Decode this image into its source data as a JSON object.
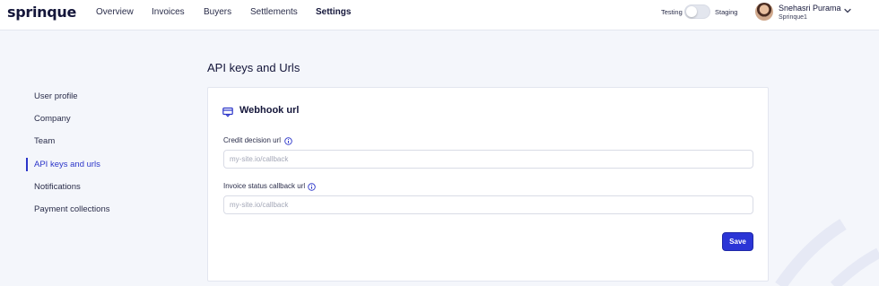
{
  "brand": {
    "logo_text": "sprinque"
  },
  "nav": {
    "items": [
      {
        "label": "Overview",
        "active": false
      },
      {
        "label": "Invoices",
        "active": false
      },
      {
        "label": "Buyers",
        "active": false
      },
      {
        "label": "Settlements",
        "active": false
      },
      {
        "label": "Settings",
        "active": true
      }
    ]
  },
  "environment": {
    "left_label": "Testing",
    "right_label": "Staging",
    "toggle_on": false
  },
  "user": {
    "name": "Snehasri Purama",
    "org": "Sprinque1"
  },
  "sidebar": {
    "items": [
      {
        "label": "User profile",
        "active": false
      },
      {
        "label": "Company",
        "active": false
      },
      {
        "label": "Team",
        "active": false
      },
      {
        "label": "API keys and urls",
        "active": true
      },
      {
        "label": "Notifications",
        "active": false
      },
      {
        "label": "Payment collections",
        "active": false
      }
    ]
  },
  "page": {
    "title": "API keys and Urls"
  },
  "webhook": {
    "title": "Webhook url",
    "credit_label": "Credit decision url",
    "credit_value": "",
    "credit_placeholder": "my-site.io/callback",
    "invoice_label": "Invoice status callback url",
    "invoice_value": "",
    "invoice_placeholder": "my-site.io/callback",
    "save_label": "Save"
  },
  "colors": {
    "accent": "#2b35d6",
    "background": "#f4f6fb"
  }
}
